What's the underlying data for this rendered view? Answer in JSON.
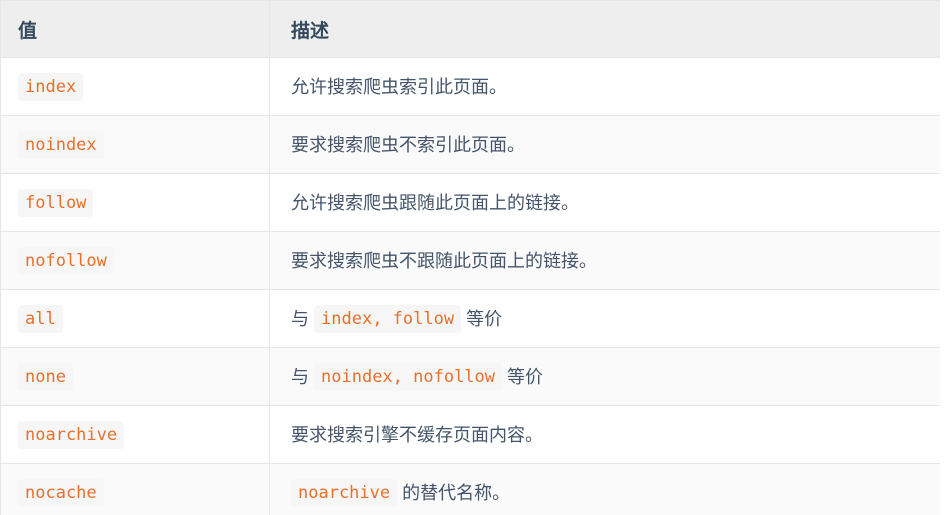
{
  "table": {
    "headers": {
      "value": "值",
      "description": "描述"
    },
    "rows": [
      {
        "value": "index",
        "desc_parts": [
          {
            "type": "text",
            "text": "允许搜索爬虫索引此页面。"
          }
        ]
      },
      {
        "value": "noindex",
        "desc_parts": [
          {
            "type": "text",
            "text": "要求搜索爬虫不索引此页面。"
          }
        ]
      },
      {
        "value": "follow",
        "desc_parts": [
          {
            "type": "text",
            "text": "允许搜索爬虫跟随此页面上的链接。"
          }
        ]
      },
      {
        "value": "nofollow",
        "desc_parts": [
          {
            "type": "text",
            "text": "要求搜索爬虫不跟随此页面上的链接。"
          }
        ]
      },
      {
        "value": "all",
        "desc_parts": [
          {
            "type": "text",
            "text": "与 "
          },
          {
            "type": "code",
            "text": "index, follow"
          },
          {
            "type": "text",
            "text": " 等价"
          }
        ]
      },
      {
        "value": "none",
        "desc_parts": [
          {
            "type": "text",
            "text": "与 "
          },
          {
            "type": "code",
            "text": "noindex, nofollow"
          },
          {
            "type": "text",
            "text": " 等价"
          }
        ]
      },
      {
        "value": "noarchive",
        "desc_parts": [
          {
            "type": "text",
            "text": "要求搜索引擎不缓存页面内容。"
          }
        ]
      },
      {
        "value": "nocache",
        "desc_parts": [
          {
            "type": "code",
            "text": "noarchive"
          },
          {
            "type": "text",
            "text": " 的替代名称。"
          }
        ]
      }
    ]
  },
  "colors": {
    "header_bg": "#eeeeee",
    "header_text": "#34495e",
    "body_text": "#44546a",
    "code_text": "#e8702a",
    "code_bg": "#f6f6f7",
    "border": "#e3e7ea",
    "row_alt_bg": "#fafafa"
  }
}
